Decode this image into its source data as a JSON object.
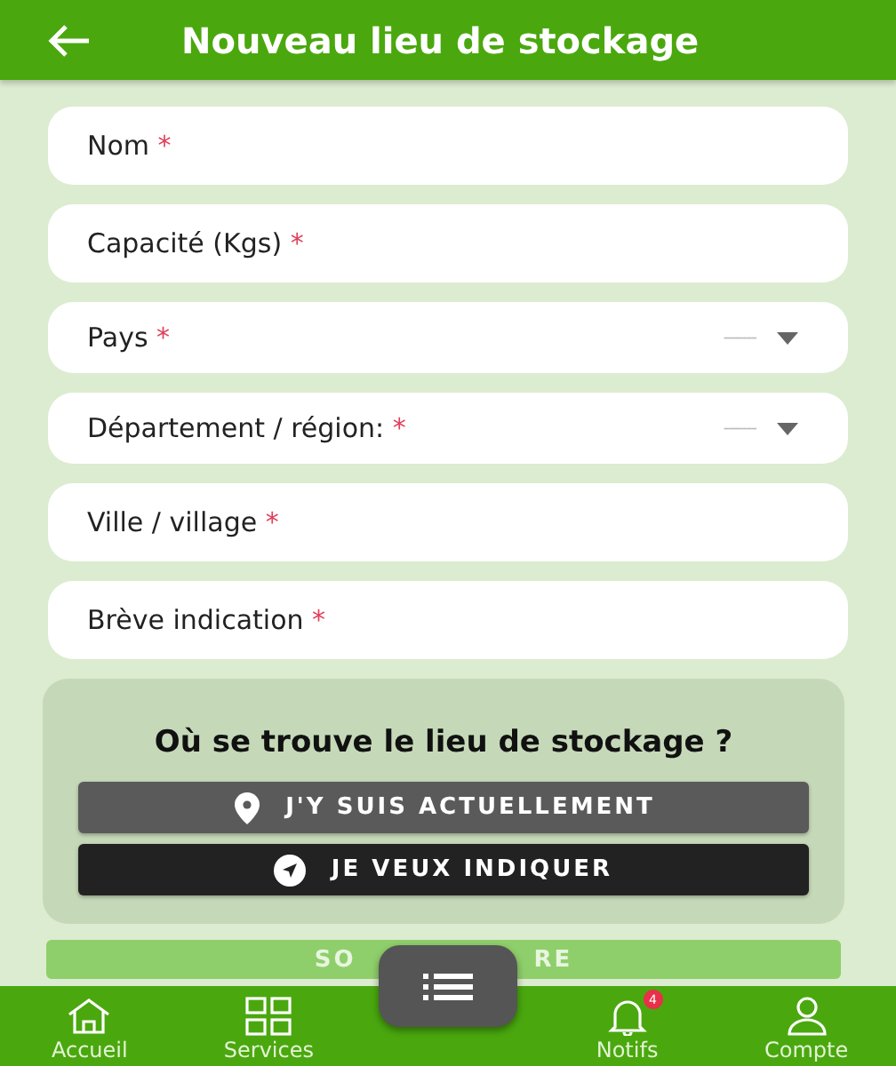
{
  "header": {
    "title": "Nouveau lieu de stockage"
  },
  "fields": [
    {
      "kind": "text",
      "label": "Nom",
      "required_mark": "*"
    },
    {
      "kind": "text",
      "label": "Capacité (Kgs)",
      "required_mark": "*"
    },
    {
      "kind": "select",
      "label": "Pays",
      "required_mark": "*",
      "placeholder": "-------"
    },
    {
      "kind": "select",
      "label": "Département / région:",
      "required_mark": "*",
      "placeholder": "-------"
    },
    {
      "kind": "text",
      "label": "Ville / village",
      "required_mark": "*"
    },
    {
      "kind": "text",
      "label": "Brève indication",
      "required_mark": "*"
    }
  ],
  "location": {
    "question": "Où se trouve le lieu de stockage ?",
    "buttons": [
      {
        "kind": "pin",
        "label": "J'Y SUIS ACTUELLEMENT"
      },
      {
        "kind": "navigate",
        "label": "JE VEUX INDIQUER"
      }
    ]
  },
  "submit": {
    "visible_parts": [
      "SO",
      "RE"
    ]
  },
  "bottom_nav": [
    {
      "kind": "home",
      "label": "Accueil"
    },
    {
      "kind": "grid",
      "label": "Services"
    },
    {
      "kind": "menu"
    },
    {
      "kind": "bell",
      "label": "Notifs",
      "badge": "4"
    },
    {
      "kind": "person",
      "label": "Compte"
    }
  ]
}
